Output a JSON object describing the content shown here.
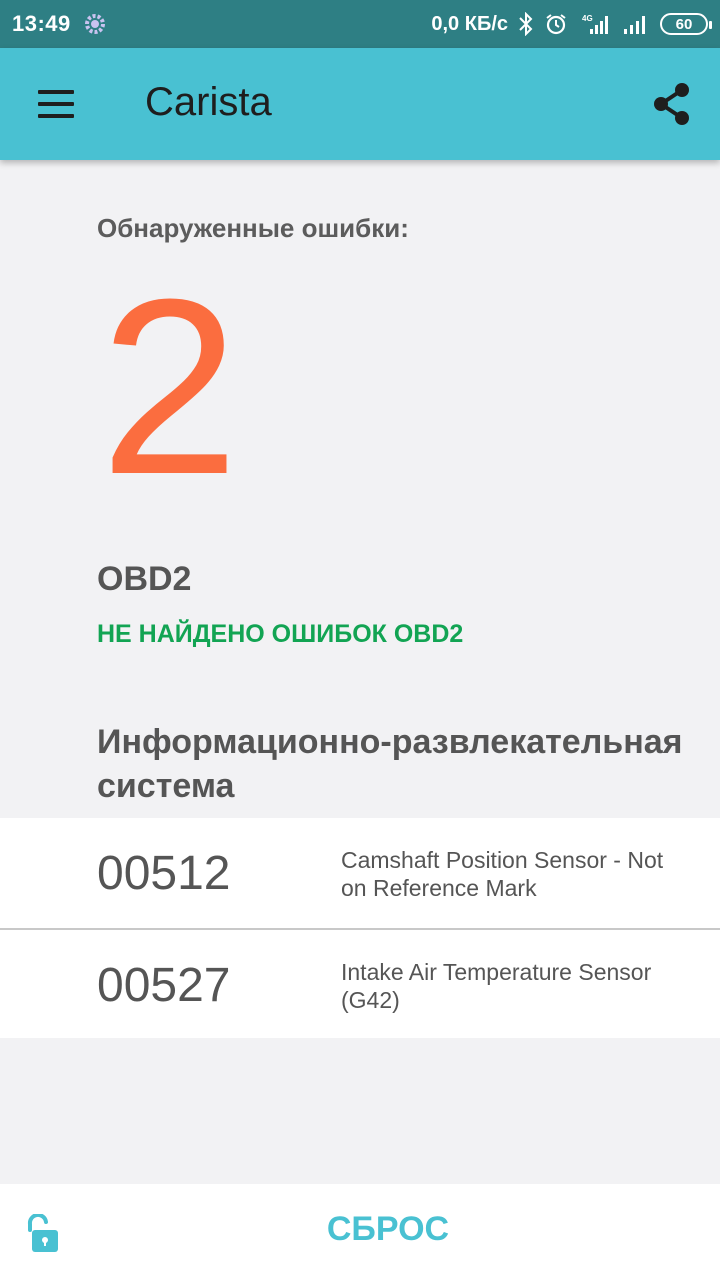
{
  "status_bar": {
    "time": "13:49",
    "network_speed": "0,0 КБ/с",
    "battery": "60",
    "icons": [
      "settings-gear-icon",
      "bluetooth-icon",
      "alarm-icon",
      "signal-4g-icon",
      "signal-icon",
      "battery-icon"
    ]
  },
  "app_bar": {
    "title": "Carista",
    "background": "#49c1d2",
    "icons": [
      "menu-icon",
      "share-icon"
    ]
  },
  "summary": {
    "label": "Обнаруженные ошибки:",
    "error_count": "2",
    "count_color": "#fb6d3f"
  },
  "obd": {
    "title": "OBD2",
    "status": "НЕ НАЙДЕНО ОШИБОК OBD2",
    "status_color": "#12a453"
  },
  "infotainment": {
    "title": "Информационно-развлекательная система",
    "faults": [
      {
        "code": "00512",
        "description": "Camshaft Position Sensor - Not on Reference Mark"
      },
      {
        "code": "00527",
        "description": "Intake Air Temperature Sensor (G42)"
      }
    ]
  },
  "bottom_bar": {
    "reset_label": "СБРОС",
    "icons": [
      "unlock-icon"
    ]
  }
}
